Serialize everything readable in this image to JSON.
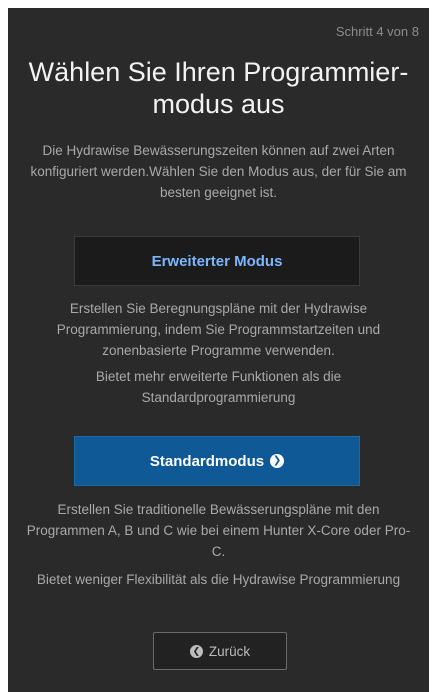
{
  "step_indicator": "Schritt 4 von 8",
  "title": "Wählen Sie Ihren Programmier-modus aus",
  "intro": "Die Hydrawise Bewässerungszeiten können auf zwei Arten konfiguriert werden.Wählen Sie den Modus aus, der für Sie am besten geeignet ist.",
  "advanced": {
    "label": "Erweiterter Modus",
    "description": "Erstellen Sie Beregnungspläne mit der Hydrawise Programmierung, indem Sie Programmstartzeiten und zonenbasierte Programme verwenden.",
    "note": "Bietet mehr erweiterte Funktionen als die Standardprogrammierung"
  },
  "standard": {
    "label": "Standardmodus",
    "icon": "chevron-circle-right-icon",
    "description": "Erstellen Sie traditionelle Bewässerungspläne mit den Programmen A, B und C wie bei einem Hunter X-Core oder Pro-C.",
    "note": "Bietet weniger Flexibilität als die Hydrawise Programmierung"
  },
  "back": {
    "label": "Zurück",
    "icon": "chevron-circle-left-icon"
  },
  "colors": {
    "panel_bg": "#2a2a2a",
    "primary_button": "#0f5a96",
    "advanced_text": "#7cb6ff"
  }
}
